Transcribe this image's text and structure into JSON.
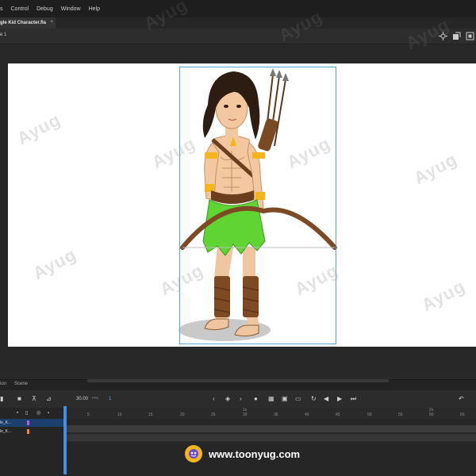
{
  "menu": {
    "items": [
      "s",
      "Control",
      "Debug",
      "Window",
      "Help"
    ]
  },
  "document": {
    "tab_title": "gle Kid Character.fla",
    "close_glyph": "×"
  },
  "editbar": {
    "scene_label": "e 1"
  },
  "watermark": {
    "text": "Ayug"
  },
  "timeline": {
    "tabs": [
      "ion",
      "Scene"
    ],
    "fps_value": "30.00",
    "fps_unit": "FPS",
    "current_frame": "1",
    "ruler_ticks": [
      "5",
      "10",
      "15",
      "20",
      "25",
      "30",
      "35",
      "40",
      "45",
      "50",
      "55",
      "60",
      "65"
    ],
    "ruler_seconds": [
      "1s",
      "2s"
    ],
    "layers": [
      {
        "name": "le_K...",
        "color": "#b05fd6",
        "selected": true
      },
      {
        "name": "le_K...",
        "color": "#f08a24",
        "selected": false
      }
    ]
  },
  "branding": {
    "url": "www.toonyug.com"
  },
  "colors": {
    "stage_bg": "#ffffff",
    "pasteboard": "#282828",
    "selection_border": "#56a7d6",
    "accent": "#4a8de0",
    "logo": "#f3b51b"
  }
}
